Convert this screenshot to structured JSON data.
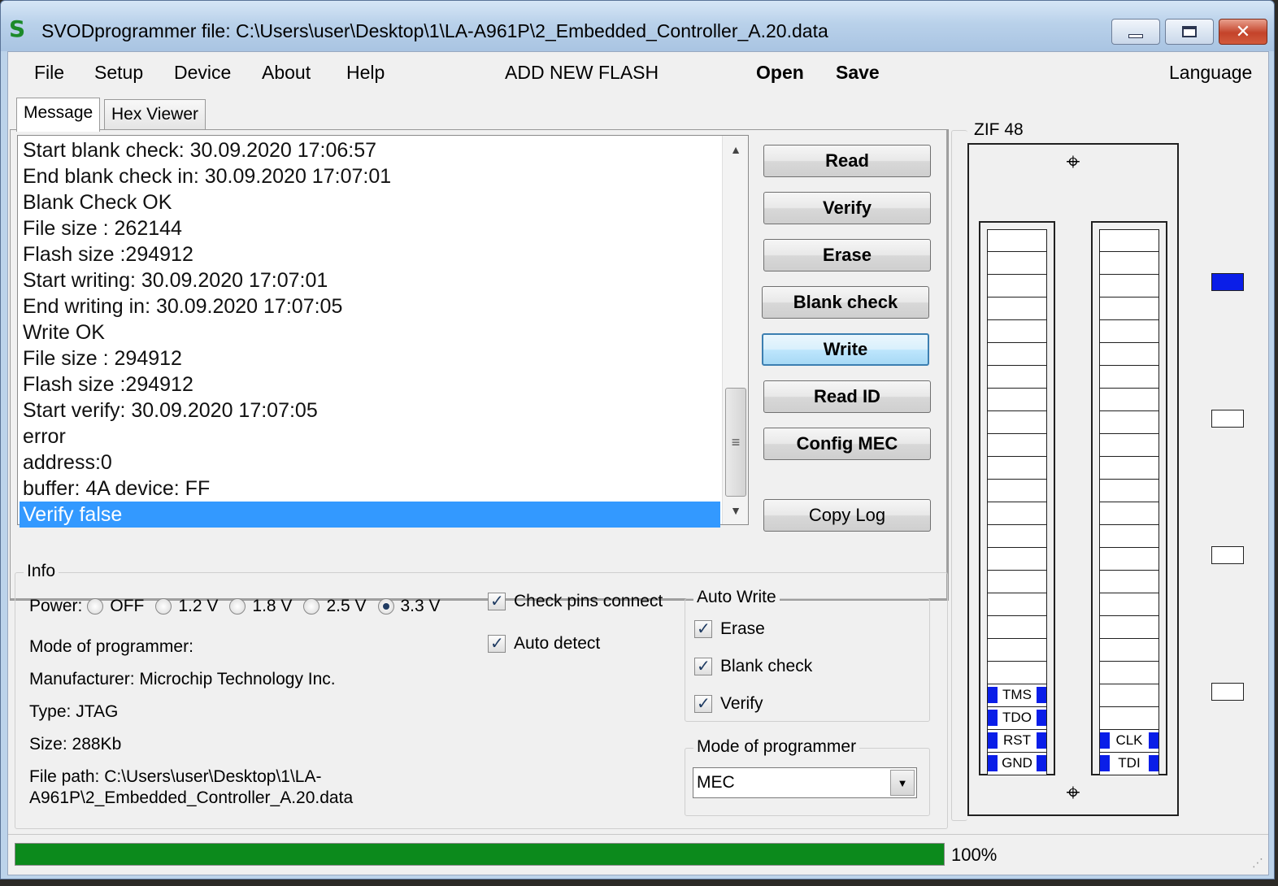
{
  "window": {
    "title": "SVODprogrammer file: C:\\Users\\user\\Desktop\\1\\LA-A961P\\2_Embedded_Controller_A.20.data",
    "icon": "S"
  },
  "menu": {
    "file": "File",
    "setup": "Setup",
    "device": "Device",
    "about": "About",
    "help": "Help",
    "add_new_flash": "ADD NEW FLASH",
    "open": "Open",
    "save": "Save",
    "language": "Language"
  },
  "tabs": {
    "message": "Message",
    "hex_viewer": "Hex Viewer"
  },
  "log": [
    "Start blank check: 30.09.2020 17:06:57",
    "End blank check in: 30.09.2020 17:07:01",
    "Blank Check OK",
    "File size : 262144",
    "Flash size :294912",
    "Start writing: 30.09.2020 17:07:01",
    "End writing in: 30.09.2020 17:07:05",
    "Write OK",
    "File size : 294912",
    "Flash size :294912",
    "Start verify: 30.09.2020 17:07:05",
    "error",
    "address:0",
    "buffer: 4A device: FF",
    "Verify false"
  ],
  "buttons": {
    "read": "Read",
    "verify": "Verify",
    "erase": "Erase",
    "blank_check": "Blank check",
    "write": "Write",
    "read_id": "Read ID",
    "config_mec": "Config MEC",
    "copy_log": "Copy Log"
  },
  "info": {
    "legend": "Info",
    "power_label": "Power:",
    "power_options": [
      "OFF",
      "1.2 V",
      "1.8 V",
      "2.5 V",
      "3.3 V"
    ],
    "power_selected": "3.3 V",
    "check_pins_connect": "Check pins connect",
    "auto_detect": "Auto detect",
    "mode_of_programmer": "Mode of programmer:",
    "manufacturer": "Manufacturer: Microchip Technology Inc.",
    "type": "Type: JTAG",
    "size": "Size: 288Kb",
    "file_path_line1": "File path: C:\\Users\\user\\Desktop\\1\\LA-",
    "file_path_line2": "A961P\\2_Embedded_Controller_A.20.data"
  },
  "auto_write": {
    "legend": "Auto Write",
    "erase": "Erase",
    "blank_check": "Blank check",
    "verify": "Verify"
  },
  "mode_group": {
    "legend": "Mode of programmer",
    "selected": "MEC"
  },
  "zif": {
    "legend": "ZIF 48",
    "left_labels": [
      "TMS",
      "TDO",
      "RST",
      "GND"
    ],
    "right_labels": [
      "CLK",
      "TDI"
    ]
  },
  "status": {
    "progress_percent": 100,
    "progress_label": "100%"
  },
  "colors": {
    "progress": "#0c8a1c",
    "selection": "#3399ff",
    "pin_marker": "#0a1ee8"
  }
}
